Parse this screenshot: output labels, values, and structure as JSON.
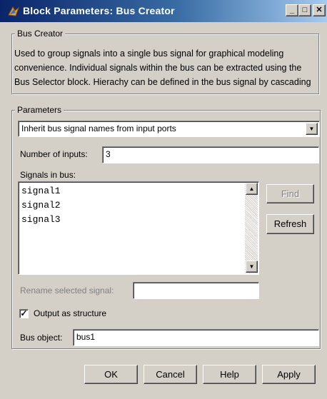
{
  "window": {
    "title": "Block Parameters: Bus Creator",
    "minimize_label": "_",
    "maximize_label": "□",
    "close_label": "✕"
  },
  "description": {
    "legend": "Bus Creator",
    "text": "Used to group signals into a single bus signal for graphical modeling convenience. Individual signals within the bus can be extracted using the Bus Selector block. Hierachy can be defined in the bus signal by cascading Bus Creator blocks."
  },
  "parameters": {
    "legend": "Parameters",
    "signal_naming": {
      "selected": "Inherit bus signal names from input ports"
    },
    "number_of_inputs": {
      "label": "Number of inputs:",
      "value": "3"
    },
    "signals_in_bus": {
      "label": "Signals in bus:",
      "items": [
        "signal1",
        "signal2",
        "signal3"
      ]
    },
    "find_label": "Find",
    "refresh_label": "Refresh",
    "rename": {
      "label": "Rename selected signal:",
      "value": ""
    },
    "output_as_structure": {
      "label": "Output as structure",
      "checked": true
    },
    "bus_object": {
      "label": "Bus object:",
      "value": "bus1"
    }
  },
  "buttons": {
    "ok": "OK",
    "cancel": "Cancel",
    "help": "Help",
    "apply": "Apply"
  },
  "colors": {
    "titlebar_start": "#0a246a",
    "titlebar_end": "#a6caf0",
    "face": "#d4d0c8",
    "disabled_text": "#808080"
  }
}
